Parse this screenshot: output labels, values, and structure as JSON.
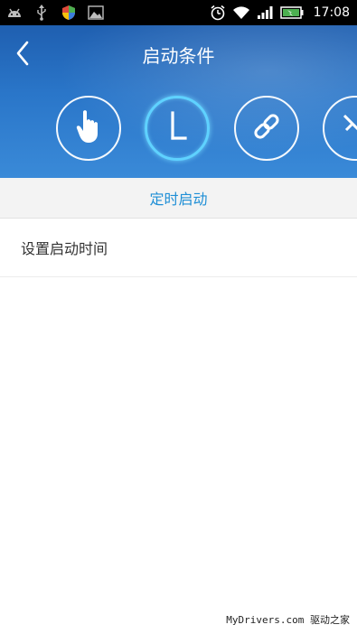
{
  "status_bar": {
    "time": "17:08",
    "left_icons": [
      "android-debug-icon",
      "usb-icon",
      "shield-icon",
      "image-icon"
    ],
    "right_icons": [
      "alarm-icon",
      "wifi-icon",
      "signal-icon",
      "battery-icon"
    ]
  },
  "header": {
    "title": "启动条件",
    "back_icon": "chevron-left-icon",
    "condition_icons": [
      "touch-icon",
      "clock-icon",
      "link-icon",
      "unlink-icon"
    ],
    "active_index": 1
  },
  "subtab": {
    "label": "定时启动",
    "color": "#1f8fd6"
  },
  "settings": {
    "items": [
      {
        "label": "设置启动时间"
      }
    ]
  },
  "watermark": {
    "text": "MyDrivers.com 驱动之家"
  }
}
